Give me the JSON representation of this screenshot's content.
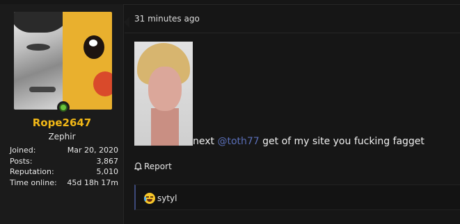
{
  "user": {
    "username": "Rope2647",
    "title": "Zephir",
    "stats": [
      {
        "key": "Joined:",
        "value": "Mar 20, 2020"
      },
      {
        "key": "Posts:",
        "value": "3,867"
      },
      {
        "key": "Reputation:",
        "value": "5,010"
      },
      {
        "key": "Time online:",
        "value": "45d 18h 17m"
      }
    ],
    "online": true
  },
  "post": {
    "timestamp": "31 minutes ago",
    "message_prefix": "next ",
    "mention": "@toth77",
    "message_suffix": " get of my site you fucking fagget",
    "report_label": "Report"
  },
  "reactions": {
    "emoji": "laughing-crying-emoji",
    "user": "sytyl"
  },
  "colors": {
    "username": "#f2b817",
    "mention": "#5a6fb8",
    "online": "#6ac33c",
    "reaction_bar_accent": "#3d4a7a"
  }
}
